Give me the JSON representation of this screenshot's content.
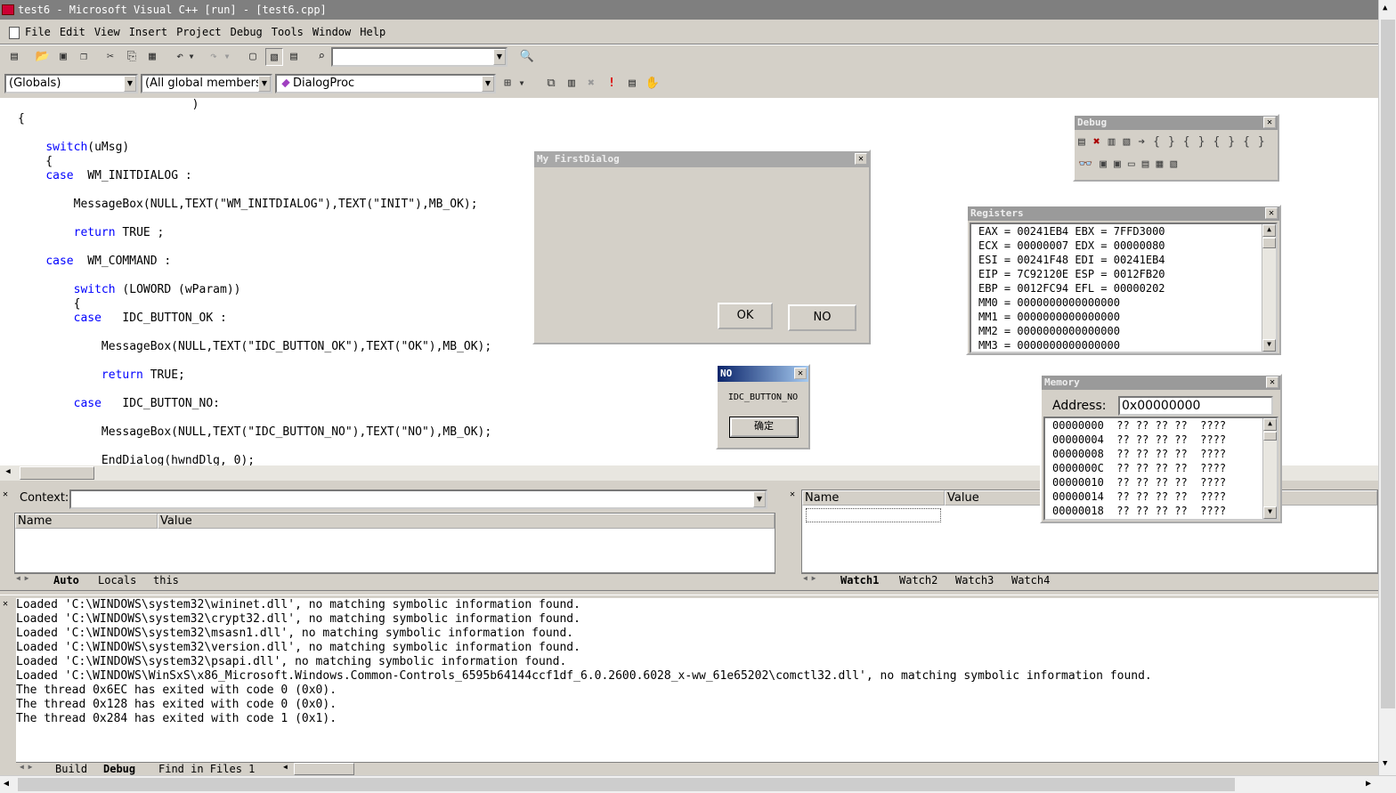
{
  "window": {
    "title": "test6 - Microsoft Visual C++ [run] - [test6.cpp]"
  },
  "menu": [
    "File",
    "Edit",
    "View",
    "Insert",
    "Project",
    "Debug",
    "Tools",
    "Window",
    "Help"
  ],
  "toolbar": {
    "find_value": ""
  },
  "wizardbar": {
    "class": "(Globals)",
    "filter": "(All global members",
    "member": "DialogProc"
  },
  "code": [
    {
      "t": "                         )"
    },
    {
      "t": "{"
    },
    {
      "t": ""
    },
    {
      "t": "    switch(uMsg)",
      "k": "switch",
      "ki": 4
    },
    {
      "t": "    {"
    },
    {
      "t": "    case  WM_INITDIALOG :",
      "k": "case",
      "ki": 4
    },
    {
      "t": ""
    },
    {
      "t": "        MessageBox(NULL,TEXT(\"WM_INITDIALOG\"),TEXT(\"INIT\"),MB_OK);"
    },
    {
      "t": ""
    },
    {
      "t": "        return TRUE ;",
      "k": "return",
      "ki": 8
    },
    {
      "t": ""
    },
    {
      "t": "    case  WM_COMMAND :",
      "k": "case",
      "ki": 4
    },
    {
      "t": ""
    },
    {
      "t": "        switch (LOWORD (wParam))",
      "k": "switch",
      "ki": 8
    },
    {
      "t": "        {"
    },
    {
      "t": "        case   IDC_BUTTON_OK :",
      "k": "case",
      "ki": 8
    },
    {
      "t": ""
    },
    {
      "t": "            MessageBox(NULL,TEXT(\"IDC_BUTTON_OK\"),TEXT(\"OK\"),MB_OK);"
    },
    {
      "t": ""
    },
    {
      "t": "            return TRUE;",
      "k": "return",
      "ki": 12
    },
    {
      "t": ""
    },
    {
      "t": "        case   IDC_BUTTON_NO:",
      "k": "case",
      "ki": 8
    },
    {
      "t": ""
    },
    {
      "t": "            MessageBox(NULL,TEXT(\"IDC_BUTTON_NO\"),TEXT(\"NO\"),MB_OK);"
    },
    {
      "t": ""
    },
    {
      "t": "            EndDialog(hwndDlg, 0);"
    }
  ],
  "dialog": {
    "title": "My FirstDialog",
    "ok": "OK",
    "no": "NO"
  },
  "msgbox": {
    "title": "NO",
    "text": "IDC_BUTTON_NO",
    "ok": "确定"
  },
  "debugbar": {
    "title": "Debug"
  },
  "registers": {
    "title": "Registers",
    "rows": [
      "EAX = 00241EB4 EBX = 7FFD3000",
      "ECX = 00000007 EDX = 00000080",
      "ESI = 00241F48 EDI = 00241EB4",
      "EIP = 7C92120E ESP = 0012FB20",
      "EBP = 0012FC94 EFL = 00000202",
      "MM0 = 0000000000000000",
      "MM1 = 0000000000000000",
      "MM2 = 0000000000000000",
      "MM3 = 0000000000000000"
    ]
  },
  "memory": {
    "title": "Memory",
    "address_label": "Address:",
    "address_value": "0x00000000",
    "rows": [
      "00000000  ?? ?? ?? ??  ????",
      "00000004  ?? ?? ?? ??  ????",
      "00000008  ?? ?? ?? ??  ????",
      "0000000C  ?? ?? ?? ??  ????",
      "00000010  ?? ?? ?? ??  ????",
      "00000014  ?? ?? ?? ??  ????",
      "00000018  ?? ?? ?? ??  ????"
    ]
  },
  "variables": {
    "context_label": "Context:",
    "col_name": "Name",
    "col_value": "Value",
    "tabs": [
      "Auto",
      "Locals",
      "this"
    ]
  },
  "watch": {
    "col_name": "Name",
    "col_value": "Value",
    "tabs": [
      "Watch1",
      "Watch2",
      "Watch3",
      "Watch4"
    ]
  },
  "output": {
    "lines": [
      "Loaded 'C:\\WINDOWS\\system32\\wininet.dll', no matching symbolic information found.",
      "Loaded 'C:\\WINDOWS\\system32\\crypt32.dll', no matching symbolic information found.",
      "Loaded 'C:\\WINDOWS\\system32\\msasn1.dll', no matching symbolic information found.",
      "Loaded 'C:\\WINDOWS\\system32\\version.dll', no matching symbolic information found.",
      "Loaded 'C:\\WINDOWS\\system32\\psapi.dll', no matching symbolic information found.",
      "Loaded 'C:\\WINDOWS\\WinSxS\\x86_Microsoft.Windows.Common-Controls_6595b64144ccf1df_6.0.2600.6028_x-ww_61e65202\\comctl32.dll', no matching symbolic information found.",
      "The thread 0x6EC has exited with code 0 (0x0).",
      "The thread 0x128 has exited with code 0 (0x0).",
      "The thread 0x284 has exited with code 1 (0x1)."
    ],
    "tabs": [
      "Build",
      "Debug",
      "Find in Files 1"
    ]
  }
}
